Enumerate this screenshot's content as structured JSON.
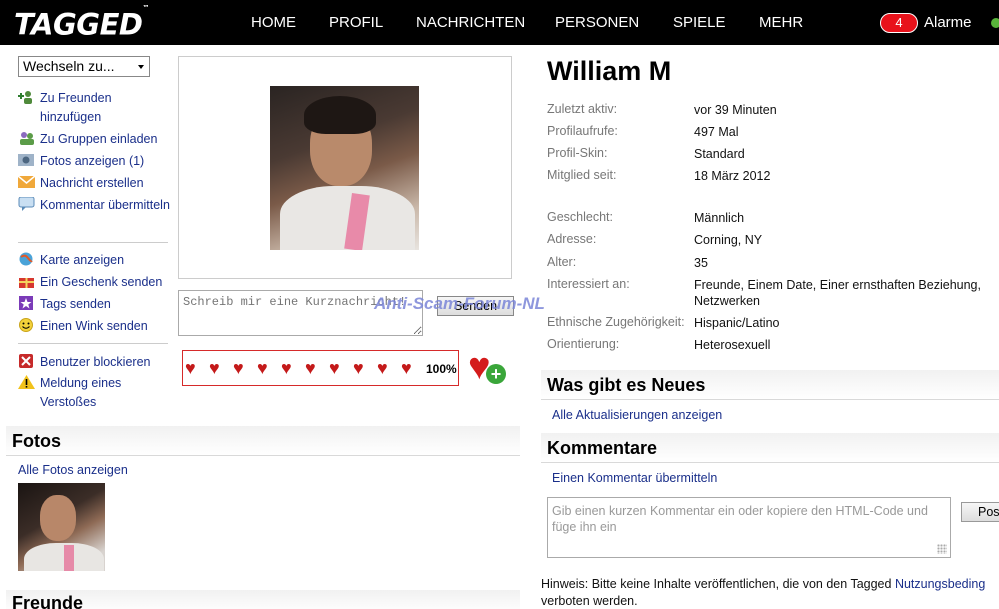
{
  "header": {
    "logo": "TAGGED",
    "logo_tm": "™",
    "nav": [
      "HOME",
      "PROFIL",
      "NACHRICHTEN",
      "PERSONEN",
      "SPIELE",
      "MEHR"
    ],
    "alarm_count": "4",
    "alarm_label": "Alarme"
  },
  "sidebar": {
    "switch_label": "Wechseln zu...",
    "actions": [
      {
        "label": "Zu Freunden hinzufügen",
        "icon": "add-friend-icon"
      },
      {
        "label": "Zu Gruppen einladen",
        "icon": "invite-group-icon"
      },
      {
        "label": "Fotos anzeigen (1)",
        "icon": "photos-icon"
      },
      {
        "label": "Nachricht erstellen",
        "icon": "envelope-icon"
      },
      {
        "label": "Kommentar übermitteln",
        "icon": "comment-icon"
      },
      {
        "label": "Karte anzeigen",
        "icon": "map-icon"
      },
      {
        "label": "Ein Geschenk senden",
        "icon": "gift-icon"
      },
      {
        "label": "Tags senden",
        "icon": "star-icon"
      },
      {
        "label": "Einen Wink senden",
        "icon": "smiley-icon"
      },
      {
        "label": "Benutzer blockieren",
        "icon": "block-icon"
      },
      {
        "label": "Meldung eines Verstoßes",
        "icon": "warning-icon"
      }
    ]
  },
  "profile": {
    "name": "William M",
    "shout_placeholder": "Schreib mir eine Kurznachricht!",
    "send_label": "Senden",
    "watermark": "Anti-Scam-Forum-NL",
    "hearts_percent": "100%",
    "hearts_filled": 10,
    "info": [
      {
        "key": "Zuletzt aktiv:",
        "value": "vor 39 Minuten"
      },
      {
        "key": "Profilaufrufe:",
        "value": "497 Mal"
      },
      {
        "key": "Profil-Skin:",
        "value": "Standard"
      },
      {
        "key": "Mitglied seit:",
        "value": "18 März 2012"
      },
      {
        "key": "Geschlecht:",
        "value": "Männlich"
      },
      {
        "key": "Adresse:",
        "value": "Corning, NY"
      },
      {
        "key": "Alter:",
        "value": "35"
      },
      {
        "key": "Interessiert an:",
        "value": "Freunde, Einem Date, Einer ernsthaften Beziehung, Netzwerken"
      },
      {
        "key": "Ethnische Zugehörigkeit:",
        "value": "Hispanic/Latino"
      },
      {
        "key": "Orientierung:",
        "value": "Heterosexuell"
      }
    ]
  },
  "photos": {
    "title": "Fotos",
    "link": "Alle Fotos anzeigen"
  },
  "friends": {
    "title": "Freunde"
  },
  "news": {
    "title": "Was gibt es Neues",
    "link": "Alle Aktualisierungen anzeigen"
  },
  "comments": {
    "title": "Kommentare",
    "link": "Einen Kommentar übermitteln",
    "placeholder": "Gib einen kurzen Kommentar ein oder kopiere den HTML-Code und füge ihn ein",
    "post_label": "Pos",
    "notice_prefix": "Hinweis: Bitte keine Inhalte veröffentlichen, die von den Tagged ",
    "notice_link": "Nutzungsbeding",
    "notice_suffix": "verboten werden."
  },
  "colors": {
    "link": "#1a2f8a",
    "alarm": "#e8121b",
    "heart": "#c41a1a"
  }
}
